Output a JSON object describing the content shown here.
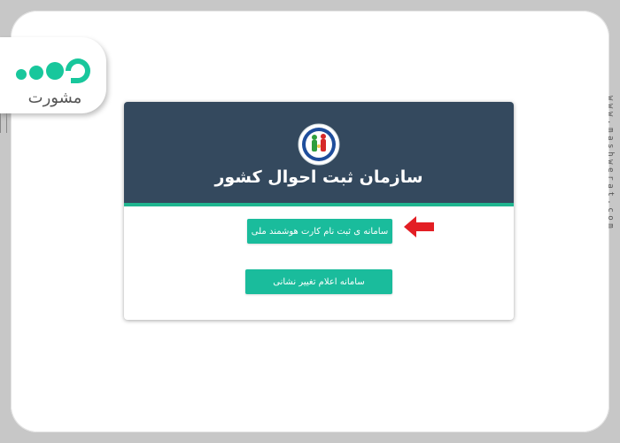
{
  "window": {
    "background_color": "#c7c7c7",
    "frame_color": "#ffffff"
  },
  "logo": {
    "text": "مشورت",
    "colors": {
      "dots": "#18c79c",
      "text": "#555555"
    },
    "icon": "mashwerat-logo"
  },
  "watermark": {
    "url_text": "www.mashwerat.com"
  },
  "card": {
    "title": "سازمان ثبت احوال کشور",
    "header_color": "#34495e",
    "accent_color": "#1fb58f",
    "emblem_icon": "civil-registration-emblem",
    "buttons": {
      "smart_card_label": "سامانه ی ثبت نام کارت هوشمند ملی",
      "address_change_label": "سامانه اعلام تغییر نشانی"
    },
    "button_color": "#1abc9c"
  },
  "annotation": {
    "pointer_icon": "red-arrow-icon",
    "pointer_color": "#e31e24"
  }
}
